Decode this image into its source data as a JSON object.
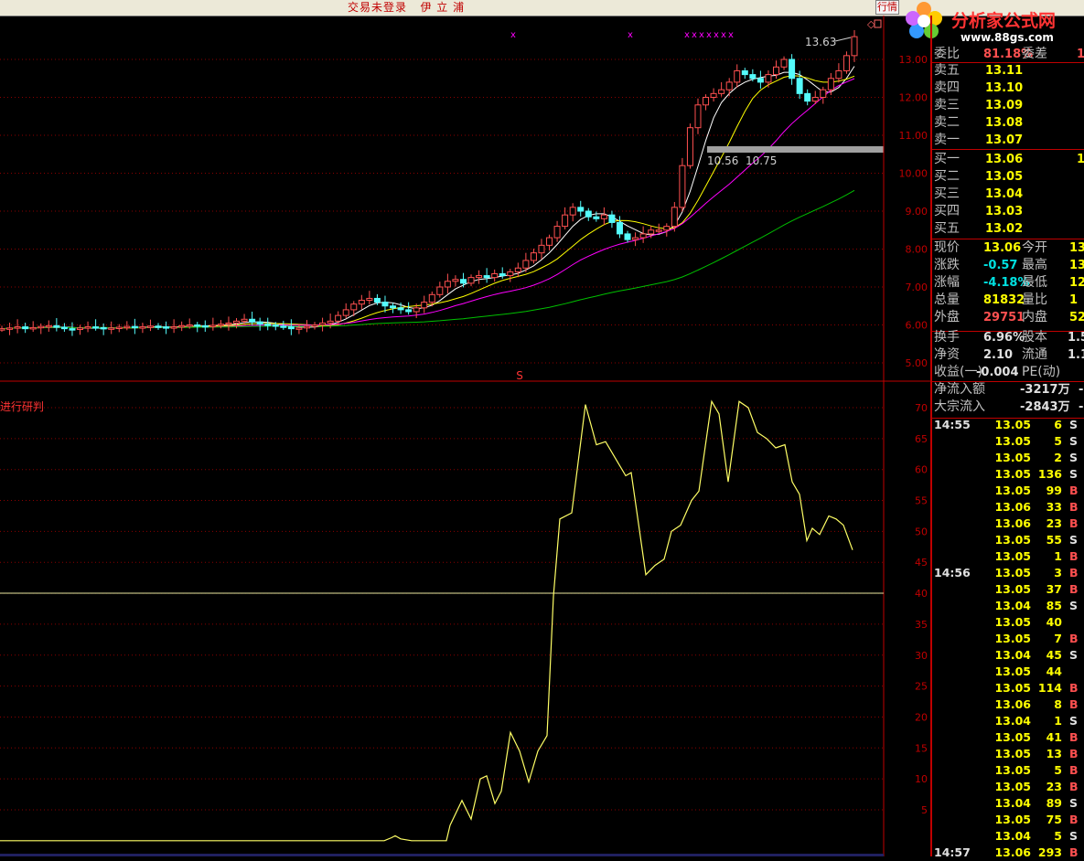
{
  "titlebar": {
    "status": "交易未登录",
    "stock_name": "伊 立 浦",
    "tab": "行情"
  },
  "logo": {
    "text": "分析家公式网",
    "url": "www.88gs.com"
  },
  "main_chart": {
    "y_ticks": [
      "13.00",
      "12.00",
      "11.00",
      "10.00",
      "9.00",
      "8.00",
      "7.00",
      "6.00",
      "5.00"
    ],
    "high_label": "13.63",
    "mid_label_a": "10.56",
    "mid_label_b": "10.75",
    "markers": [
      "x",
      "x",
      "x",
      "x",
      "x",
      "x",
      "x",
      "x",
      "x"
    ],
    "signal": "S"
  },
  "chart_data": {
    "type": "line",
    "title": "进行研判",
    "ylim": [
      0,
      73
    ],
    "y_ticks": [
      5,
      10,
      15,
      20,
      25,
      30,
      35,
      40,
      45,
      50,
      55,
      60,
      65,
      70
    ],
    "reference_line": 40,
    "x": [
      0,
      1,
      2,
      3,
      4,
      5,
      6,
      7,
      8,
      9,
      10,
      11,
      12,
      13,
      14,
      15,
      16,
      17,
      18,
      19,
      20,
      21,
      22,
      23,
      24,
      25,
      26,
      27,
      28,
      29,
      30,
      31,
      32,
      33,
      34,
      35,
      36,
      37,
      38,
      39,
      40,
      41,
      42,
      43,
      44,
      45,
      46,
      47,
      48,
      49,
      50
    ],
    "values": [
      0,
      0,
      0,
      0,
      0,
      0,
      0,
      0,
      0,
      0,
      0,
      0,
      0,
      0,
      0,
      0,
      0.8,
      0,
      0,
      0,
      3.5,
      0.6,
      4,
      10,
      6,
      15,
      12,
      18,
      13,
      50,
      48,
      70,
      66,
      62,
      57,
      55,
      46,
      44,
      50,
      48,
      56,
      60,
      67,
      63,
      72,
      71,
      68,
      64,
      64,
      58,
      46
    ]
  },
  "panel": {
    "top": {
      "l1": "委比",
      "v1": "81.18%",
      "l2": "委差",
      "v2": "1"
    },
    "sell": [
      {
        "label": "卖五",
        "price": "13.11"
      },
      {
        "label": "卖四",
        "price": "13.10"
      },
      {
        "label": "卖三",
        "price": "13.09"
      },
      {
        "label": "卖二",
        "price": "13.08"
      },
      {
        "label": "卖一",
        "price": "13.07"
      }
    ],
    "buy": [
      {
        "label": "买一",
        "price": "13.06",
        "vol": "1"
      },
      {
        "label": "买二",
        "price": "13.05",
        "vol": ""
      },
      {
        "label": "买三",
        "price": "13.04",
        "vol": ""
      },
      {
        "label": "买四",
        "price": "13.03",
        "vol": ""
      },
      {
        "label": "买五",
        "price": "13.02",
        "vol": ""
      }
    ],
    "quote": [
      {
        "l1": "现价",
        "v1": "13.06",
        "c1": "#ffff00",
        "l2": "今开",
        "v2": "13"
      },
      {
        "l1": "涨跌",
        "v1": "-0.57",
        "c1": "#00e0e0",
        "l2": "最高",
        "v2": "13"
      },
      {
        "l1": "涨幅",
        "v1": "-4.18%",
        "c1": "#00e0e0",
        "l2": "最低",
        "v2": "12"
      },
      {
        "l1": "总量",
        "v1": "81832",
        "c1": "#ffff00",
        "l2": "量比",
        "v2": "1"
      },
      {
        "l1": "外盘",
        "v1": "29751",
        "c1": "#ff5050",
        "l2": "内盘",
        "v2": "52"
      }
    ],
    "stats": [
      {
        "l1": "换手",
        "v1": "6.96%",
        "l2": "股本",
        "v2": "1.5"
      },
      {
        "l1": "净资",
        "v1": "2.10",
        "l2": "流通",
        "v2": "1.1"
      },
      {
        "l1": "收益(一)",
        "v1": "-0.004",
        "l2": "PE(动)",
        "v2": ""
      }
    ],
    "flow": [
      {
        "label": "净流入额",
        "value": "-3217万",
        "extra": "-"
      },
      {
        "label": "大宗流入",
        "value": "-2843万",
        "extra": "-"
      }
    ],
    "ticks": [
      {
        "time": "14:55",
        "price": "13.05",
        "vol": "6",
        "side": "S"
      },
      {
        "time": "",
        "price": "13.05",
        "vol": "5",
        "side": "S"
      },
      {
        "time": "",
        "price": "13.05",
        "vol": "2",
        "side": "S"
      },
      {
        "time": "",
        "price": "13.05",
        "vol": "136",
        "side": "S"
      },
      {
        "time": "",
        "price": "13.05",
        "vol": "99",
        "side": "B"
      },
      {
        "time": "",
        "price": "13.06",
        "vol": "33",
        "side": "B"
      },
      {
        "time": "",
        "price": "13.06",
        "vol": "23",
        "side": "B"
      },
      {
        "time": "",
        "price": "13.05",
        "vol": "55",
        "side": "S"
      },
      {
        "time": "",
        "price": "13.05",
        "vol": "1",
        "side": "B"
      },
      {
        "time": "14:56",
        "price": "13.05",
        "vol": "3",
        "side": "B"
      },
      {
        "time": "",
        "price": "13.05",
        "vol": "37",
        "side": "B"
      },
      {
        "time": "",
        "price": "13.04",
        "vol": "85",
        "side": "S"
      },
      {
        "time": "",
        "price": "13.05",
        "vol": "40",
        "side": ""
      },
      {
        "time": "",
        "price": "13.05",
        "vol": "7",
        "side": "B"
      },
      {
        "time": "",
        "price": "13.04",
        "vol": "45",
        "side": "S"
      },
      {
        "time": "",
        "price": "13.05",
        "vol": "44",
        "side": ""
      },
      {
        "time": "",
        "price": "13.05",
        "vol": "114",
        "side": "B"
      },
      {
        "time": "",
        "price": "13.06",
        "vol": "8",
        "side": "B"
      },
      {
        "time": "",
        "price": "13.04",
        "vol": "1",
        "side": "S"
      },
      {
        "time": "",
        "price": "13.05",
        "vol": "41",
        "side": "B"
      },
      {
        "time": "",
        "price": "13.05",
        "vol": "13",
        "side": "B"
      },
      {
        "time": "",
        "price": "13.05",
        "vol": "5",
        "side": "B"
      },
      {
        "time": "",
        "price": "13.05",
        "vol": "23",
        "side": "B"
      },
      {
        "time": "",
        "price": "13.04",
        "vol": "89",
        "side": "S"
      },
      {
        "time": "",
        "price": "13.05",
        "vol": "75",
        "side": "B"
      },
      {
        "time": "",
        "price": "13.04",
        "vol": "5",
        "side": "S"
      },
      {
        "time": "14:57",
        "price": "13.06",
        "vol": "293",
        "side": "B"
      }
    ]
  }
}
